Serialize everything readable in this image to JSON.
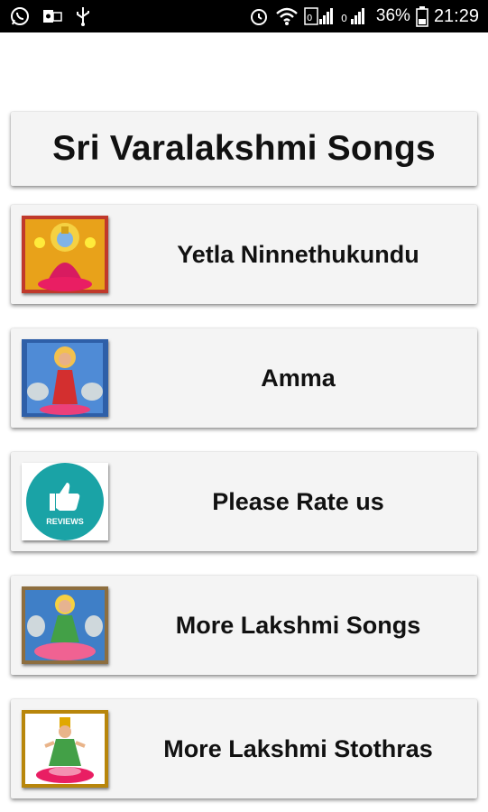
{
  "status_bar": {
    "battery": "36%",
    "time": "21:29",
    "icons": [
      "whatsapp-icon",
      "outlook-icon",
      "usb-icon",
      "alarm-icon",
      "wifi-icon",
      "signal-icon",
      "signal-icon",
      "battery-icon"
    ]
  },
  "title": "Sri Varalakshmi Songs",
  "items": [
    {
      "label": "Yetla Ninnethukundu",
      "image": "lakshmi-goddess-image"
    },
    {
      "label": "Amma",
      "image": "lakshmi-goddess-image"
    },
    {
      "label": "Please Rate us",
      "image": "reviews-thumbs-up-icon",
      "badge_text": "REVIEWS"
    },
    {
      "label": "More Lakshmi Songs",
      "image": "lakshmi-goddess-image"
    },
    {
      "label": "More Lakshmi Stothras",
      "image": "lakshmi-goddess-image"
    }
  ],
  "colors": {
    "status_bar": "#000000",
    "card_bg": "#f4f4f4",
    "reviews_teal": "#1aa3a6"
  }
}
